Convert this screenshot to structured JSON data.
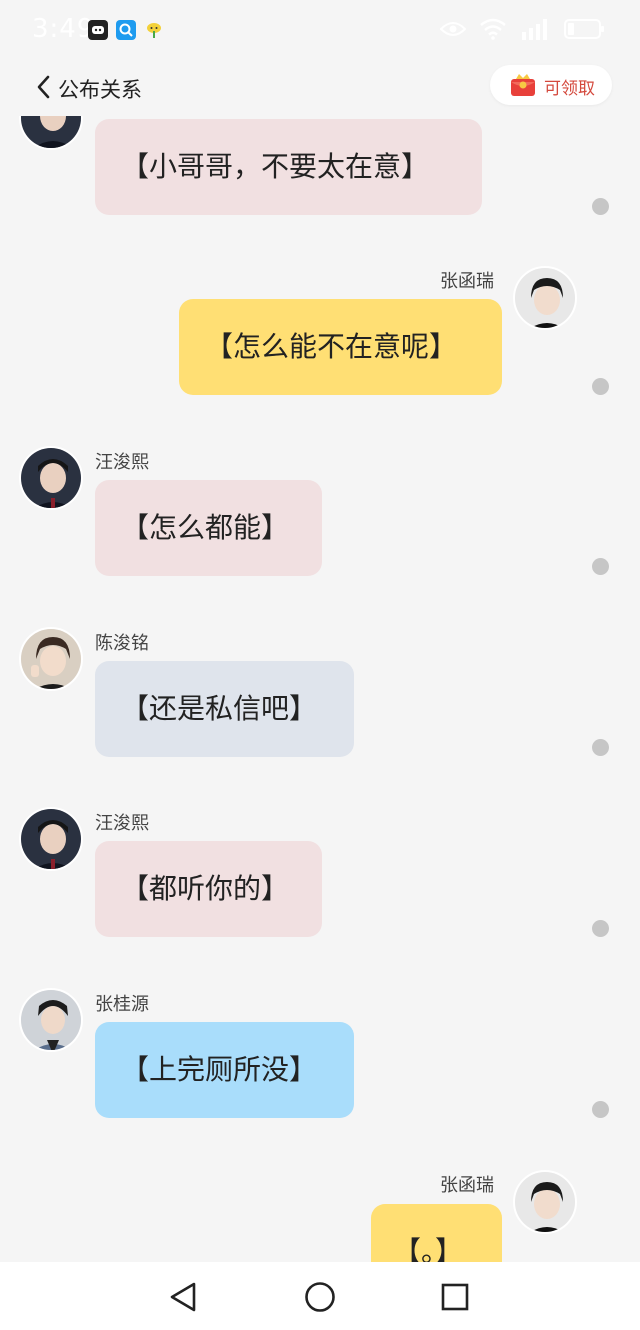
{
  "status_bar": {
    "time": "3:49",
    "app_icons": [
      "message-icon",
      "search-app-icon",
      "sprout-icon"
    ],
    "system_icons": [
      "eye-icon",
      "wifi-icon",
      "signal-icon",
      "battery-icon"
    ]
  },
  "header": {
    "title": "公布关系",
    "claim_label": "可领取",
    "back_icon": "chevron-left-icon",
    "gift_icon": "red-envelope-icon"
  },
  "messages": [
    {
      "side": "left",
      "sender": "",
      "text": "【小哥哥，不要太在意】",
      "color": "#f1e0e1"
    },
    {
      "side": "right",
      "sender": "张函瑞",
      "text": "【怎么能不在意呢】",
      "color": "#ffdf74"
    },
    {
      "side": "left",
      "sender": "汪浚熙",
      "text": "【怎么都能】",
      "color": "#f1e0e1"
    },
    {
      "side": "left",
      "sender": "陈浚铭",
      "text": "【还是私信吧】",
      "color": "#dfe4ec"
    },
    {
      "side": "left",
      "sender": "汪浚熙",
      "text": "【都听你的】",
      "color": "#f1e0e1"
    },
    {
      "side": "left",
      "sender": "张桂源",
      "text": "【上完厕所没】",
      "color": "#a9ddfb"
    },
    {
      "side": "right",
      "sender": "张函瑞",
      "text": "【。】",
      "color": "#ffdf74"
    }
  ],
  "bottom_nav": {
    "icons": [
      "back-triangle-icon",
      "home-circle-icon",
      "recents-square-icon"
    ]
  }
}
